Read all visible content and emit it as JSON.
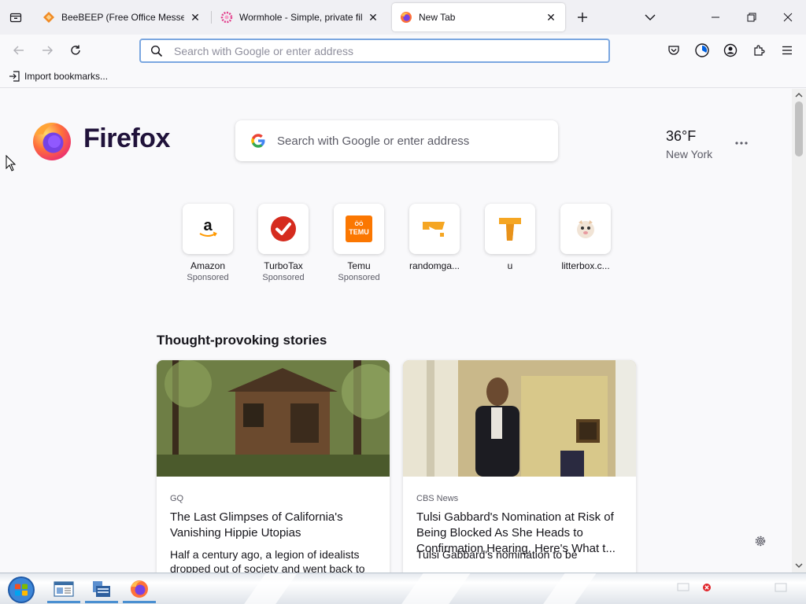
{
  "tabs": [
    {
      "title": "BeeBEEP (Free Office Messenger)",
      "favicon": "beebeep-icon",
      "active": false
    },
    {
      "title": "Wormhole - Simple, private file sharing",
      "favicon": "wormhole-icon",
      "active": false
    },
    {
      "title": "New Tab",
      "favicon": "firefox-icon",
      "active": true
    }
  ],
  "urlbar": {
    "placeholder": "Search with Google or enter address"
  },
  "bookmarks": {
    "import_label": "Import bookmarks..."
  },
  "newtab": {
    "brand": "Firefox",
    "search_placeholder": "Search with Google or enter address",
    "weather": {
      "temp": "36°F",
      "city": "New York"
    },
    "shortcuts": [
      {
        "label": "Amazon",
        "sponsored": "Sponsored",
        "icon": "amazon-icon"
      },
      {
        "label": "TurboTax",
        "sponsored": "Sponsored",
        "icon": "turbotax-icon"
      },
      {
        "label": "Temu",
        "sponsored": "Sponsored",
        "icon": "temu-icon"
      },
      {
        "label": "randomga...",
        "sponsored": "",
        "icon": "randomgame-icon"
      },
      {
        "label": "u",
        "sponsored": "",
        "icon": "u-icon"
      },
      {
        "label": "litterbox.c...",
        "sponsored": "",
        "icon": "litterbox-icon"
      }
    ],
    "stories_title": "Thought-provoking stories",
    "stories": [
      {
        "source": "GQ",
        "headline": "The Last Glimpses of California's Vanishing Hippie Utopias",
        "excerpt": "Half a century ago, a legion of idealists dropped out of society and went back to"
      },
      {
        "source": "CBS News",
        "headline": "Tulsi Gabbard's Nomination at Risk of Being Blocked As She Heads to Confirmation Hearing. Here's What t...",
        "excerpt": "Tulsi Gabbard's nomination to be"
      }
    ]
  },
  "colors": {
    "accent": "#7ba7e0",
    "wordmark": "#20123a",
    "taskbar_accent": "#4a8fd1"
  }
}
